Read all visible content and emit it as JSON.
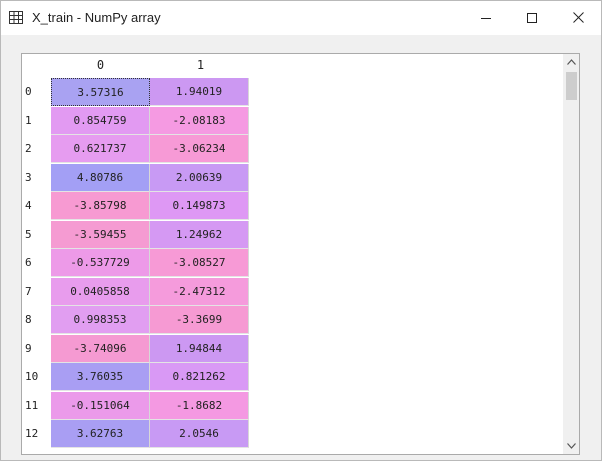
{
  "window": {
    "title": "X_train - NumPy array",
    "icon": "grid-icon",
    "controls": [
      "minimize-icon",
      "maximize-icon",
      "close-icon"
    ]
  },
  "table": {
    "columns": [
      "0",
      "1"
    ],
    "rows": [
      {
        "index": "0",
        "cells": [
          "3.57316",
          "1.94019"
        ],
        "colors": [
          "#a9a2f2",
          "#cc98f2"
        ]
      },
      {
        "index": "1",
        "cells": [
          "0.854759",
          "-2.08183"
        ],
        "colors": [
          "#e29af2",
          "#f59ae2"
        ]
      },
      {
        "index": "2",
        "cells": [
          "0.621737",
          "-3.06234"
        ],
        "colors": [
          "#e69cf0",
          "#f79ad6"
        ]
      },
      {
        "index": "3",
        "cells": [
          "4.80786",
          "2.00639"
        ],
        "colors": [
          "#a39ff5",
          "#c89af4"
        ]
      },
      {
        "index": "4",
        "cells": [
          "-3.85798",
          "0.149873"
        ],
        "colors": [
          "#f79ad2",
          "#de98f4"
        ]
      },
      {
        "index": "5",
        "cells": [
          "-3.59455",
          "1.24962"
        ],
        "colors": [
          "#f59bd2",
          "#d599f3"
        ]
      },
      {
        "index": "6",
        "cells": [
          "-0.537729",
          "-3.08527"
        ],
        "colors": [
          "#ed9ae8",
          "#f79ad6"
        ]
      },
      {
        "index": "7",
        "cells": [
          "0.0405858",
          "-2.47312"
        ],
        "colors": [
          "#e89ced",
          "#f59bdc"
        ]
      },
      {
        "index": "8",
        "cells": [
          "0.998353",
          "-3.3699"
        ],
        "colors": [
          "#e19ef1",
          "#f69ad3"
        ]
      },
      {
        "index": "9",
        "cells": [
          "-3.74096",
          "1.94844"
        ],
        "colors": [
          "#f59ad2",
          "#cc98f2"
        ]
      },
      {
        "index": "10",
        "cells": [
          "3.76035",
          "0.821262"
        ],
        "colors": [
          "#a99ef3",
          "#d999f5"
        ]
      },
      {
        "index": "11",
        "cells": [
          "-0.151064",
          "-1.8682"
        ],
        "colors": [
          "#eb9aea",
          "#f499e2"
        ]
      },
      {
        "index": "12",
        "cells": [
          "3.62763",
          "2.0546"
        ],
        "colors": [
          "#a99ef3",
          "#c89af4"
        ]
      }
    ],
    "selected_cell": {
      "row": 0,
      "col": 0
    }
  }
}
